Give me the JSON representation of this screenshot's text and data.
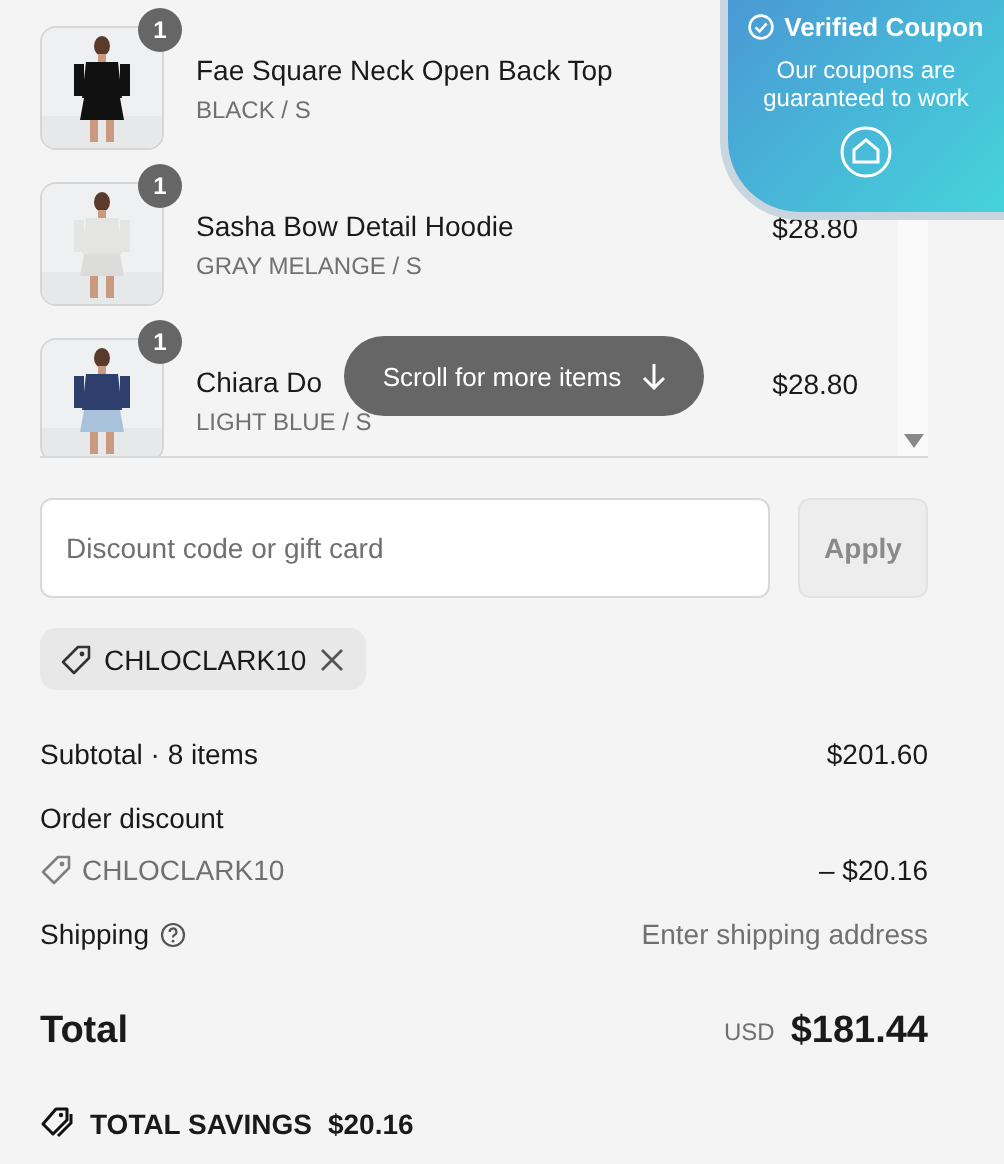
{
  "items": [
    {
      "name": "Fae Square Neck Open Back Top",
      "variant": "BLACK / S",
      "quantity": "1"
    },
    {
      "name": "Sasha Bow Detail Hoodie",
      "variant": "GRAY MELANGE / S",
      "quantity": "1",
      "price": "$28.80"
    },
    {
      "name": "Chiara Do",
      "variant": "LIGHT BLUE / S",
      "quantity": "1",
      "price": "$28.80"
    }
  ],
  "scroll_hint": {
    "label": "Scroll for more items"
  },
  "coupon_popup": {
    "title": "Verified Coupon",
    "text": "Our coupons are guaranteed to work"
  },
  "discount": {
    "placeholder": "Discount code or gift card",
    "button": "Apply",
    "disabled": true
  },
  "applied_code": {
    "code": "CHLOCLARK10"
  },
  "summary": {
    "subtotal_label": "Subtotal · 8 items",
    "subtotal": "$201.60",
    "order_discount_label": "Order discount",
    "discount_code": "CHLOCLARK10",
    "discount_amount": "– $20.16",
    "shipping_label": "Shipping",
    "shipping_value": "Enter shipping address",
    "total_label": "Total",
    "currency": "USD",
    "total": "$181.44",
    "savings_label": "TOTAL SAVINGS",
    "savings": "$20.16"
  }
}
